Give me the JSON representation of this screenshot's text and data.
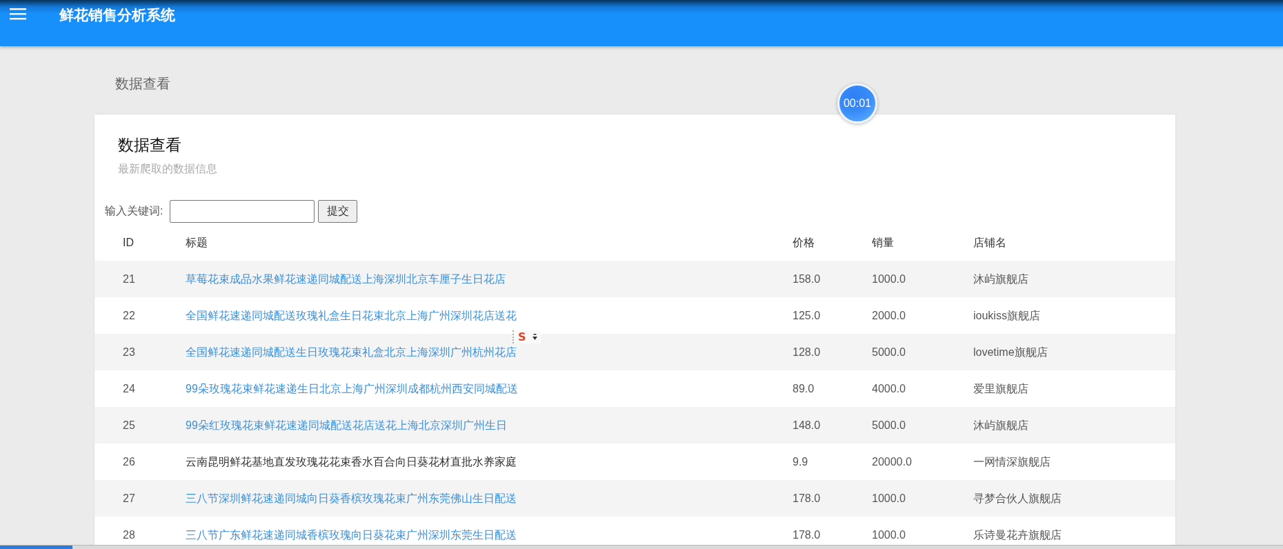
{
  "header": {
    "title": "鲜花销售分析系统"
  },
  "breadcrumb": "数据查看",
  "card": {
    "title": "数据查看",
    "subtitle": "最新爬取的数据信息",
    "search": {
      "label": "输入关键词:",
      "button": "提交"
    },
    "table": {
      "columns": [
        "ID",
        "标题",
        "价格",
        "销量",
        "店铺名"
      ],
      "rows": [
        {
          "id": "21",
          "title": "草莓花束成品水果鲜花速递同城配送上海深圳北京车厘子生日花店",
          "price": "158.0",
          "sales": "1000.0",
          "shop": "沐屿旗舰店",
          "hovered": false
        },
        {
          "id": "22",
          "title": "全国鲜花速递同城配送玫瑰礼盒生日花束北京上海广州深圳花店送花",
          "price": "125.0",
          "sales": "2000.0",
          "shop": "ioukiss旗舰店",
          "hovered": false
        },
        {
          "id": "23",
          "title": "全国鲜花速递同城配送生日玫瑰花束礼盒北京上海深圳广州杭州花店",
          "price": "128.0",
          "sales": "5000.0",
          "shop": "lovetime旗舰店",
          "hovered": false
        },
        {
          "id": "24",
          "title": "99朵玫瑰花束鲜花速递生日北京上海广州深圳成都杭州西安同城配送",
          "price": "89.0",
          "sales": "4000.0",
          "shop": "爱里旗舰店",
          "hovered": false
        },
        {
          "id": "25",
          "title": "99朵红玫瑰花束鲜花速递同城配送花店送花上海北京深圳广州生日",
          "price": "148.0",
          "sales": "5000.0",
          "shop": "沐屿旗舰店",
          "hovered": false
        },
        {
          "id": "26",
          "title": "云南昆明鲜花基地直发玫瑰花花束香水百合向日葵花材直批水养家庭",
          "price": "9.9",
          "sales": "20000.0",
          "shop": "一网情深旗舰店",
          "hovered": true
        },
        {
          "id": "27",
          "title": "三八节深圳鲜花速递同城向日葵香槟玫瑰花束广州东莞佛山生日配送",
          "price": "178.0",
          "sales": "1000.0",
          "shop": "寻梦合伙人旗舰店",
          "hovered": false
        },
        {
          "id": "28",
          "title": "三八节广东鲜花速递同城香槟玫瑰向日葵花束广州深圳东莞生日配送",
          "price": "178.0",
          "sales": "1000.0",
          "shop": "乐诗曼花卉旗舰店",
          "hovered": false
        }
      ]
    }
  },
  "timer": {
    "text": "00:01"
  },
  "ime_toolbar": {
    "logo": "S"
  }
}
